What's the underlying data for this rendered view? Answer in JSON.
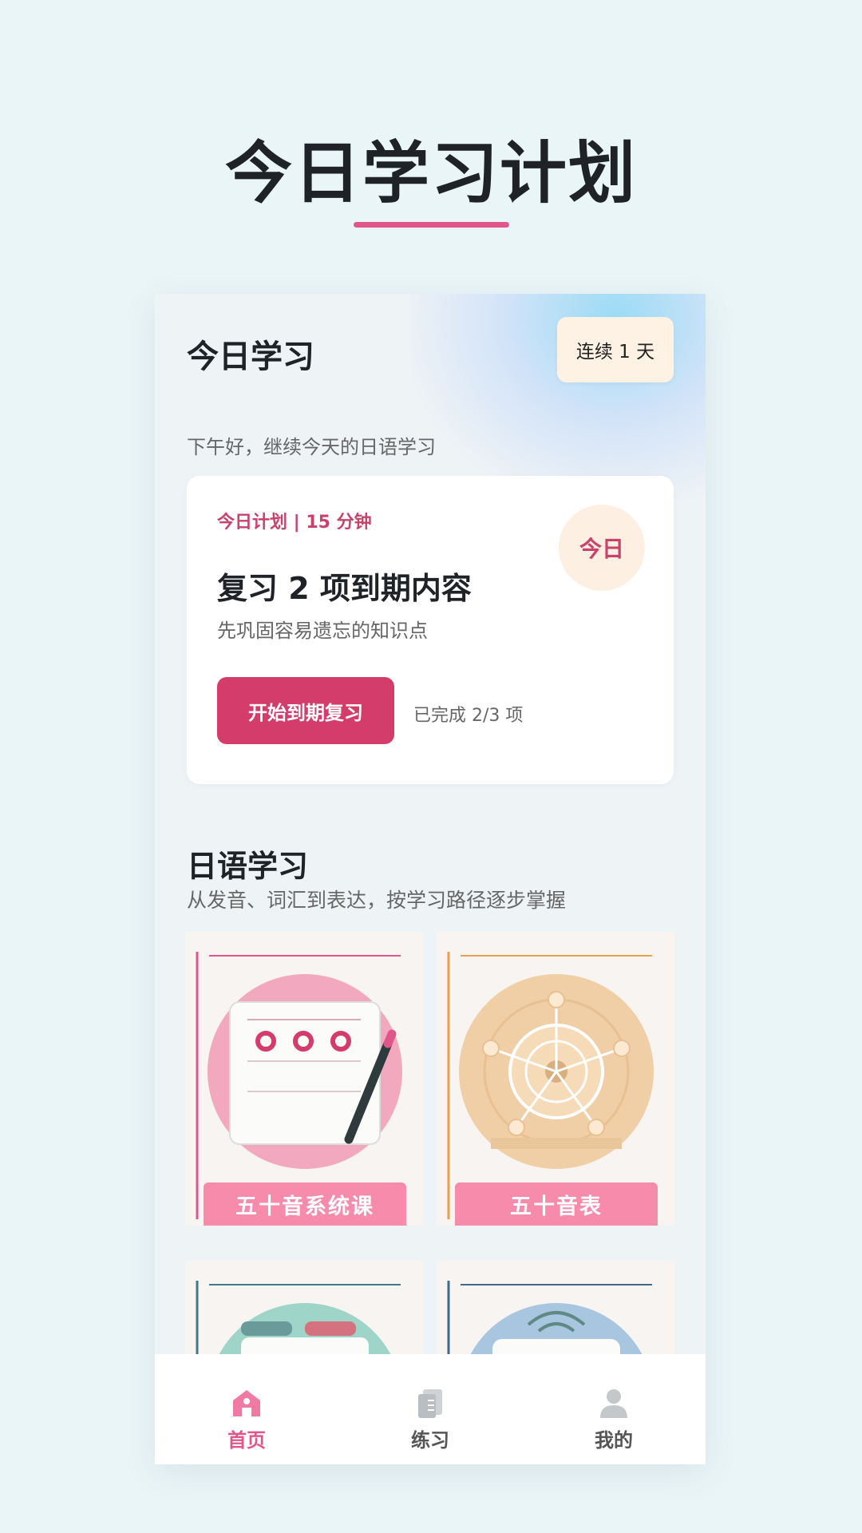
{
  "promo": {
    "title": "今日学习计划"
  },
  "header": {
    "title": "今日学习",
    "streak": "连续 1 天",
    "greeting": "下午好，继续今天的日语学习"
  },
  "plan": {
    "meta": "今日计划 | 15 分钟",
    "heading": "复习 2 项到期内容",
    "subtitle": "先巩固容易遗忘的知识点",
    "badge": "今日",
    "button": "开始到期复习",
    "progress": "已完成 2/3 项"
  },
  "section": {
    "title": "日语学习",
    "subtitle": "从发音、词汇到表达，按学习路径逐步掌握"
  },
  "courses": [
    {
      "label": "五十音系统课",
      "icon": "notebook-pen-icon",
      "color": "#f2a9bf"
    },
    {
      "label": "五十音表",
      "icon": "wheel-chart-icon",
      "color": "#f0cfa6"
    },
    {
      "label": "",
      "icon": "card-stack-icon",
      "color": "#9fd4c8"
    },
    {
      "label": "",
      "icon": "audio-card-icon",
      "color": "#a9c6e0"
    }
  ],
  "nav": [
    {
      "label": "首页",
      "icon": "home-icon",
      "active": true
    },
    {
      "label": "练习",
      "icon": "book-icon",
      "active": false
    },
    {
      "label": "我的",
      "icon": "user-icon",
      "active": false
    }
  ],
  "colors": {
    "accent": "#d43c6c",
    "accent_light": "#e0568a",
    "background": "#eaf5f7"
  }
}
